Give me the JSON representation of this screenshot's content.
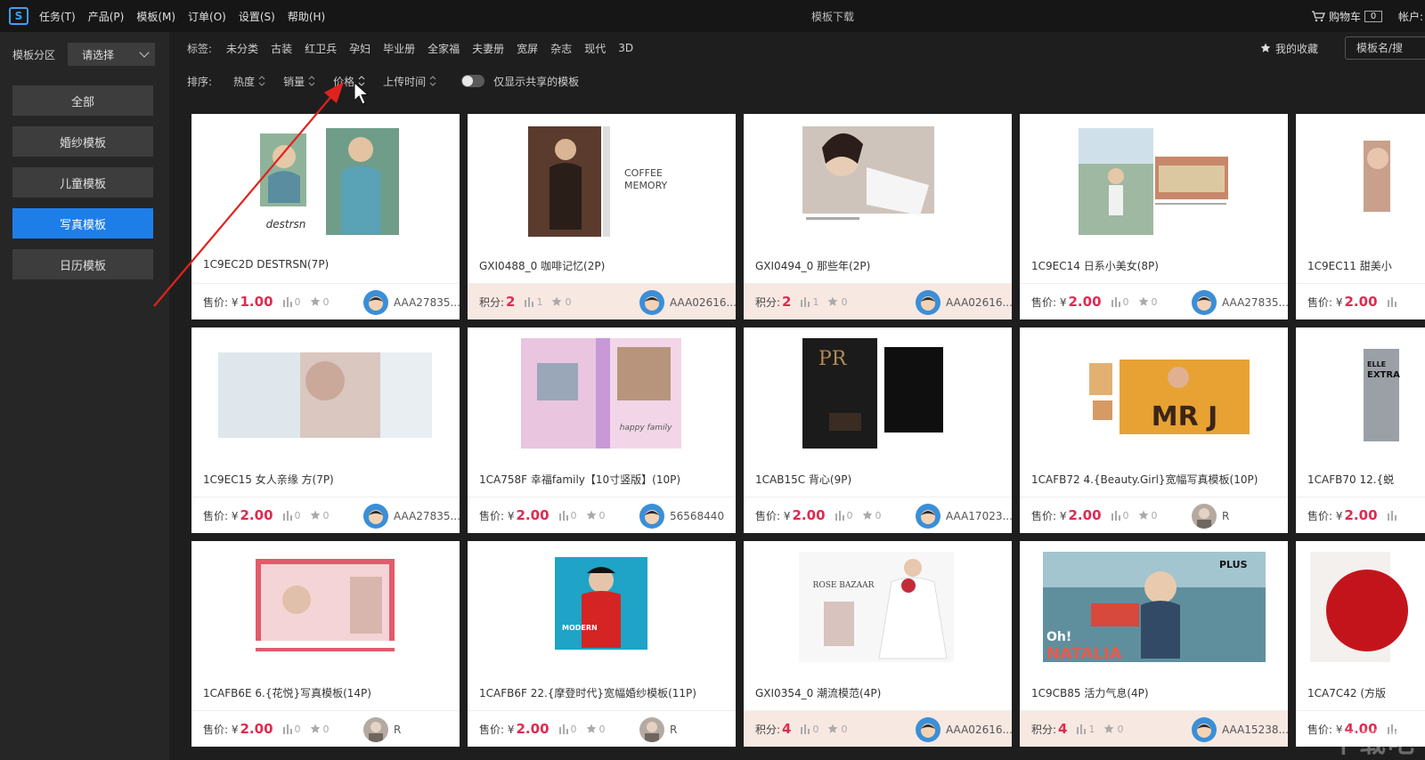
{
  "app": {
    "title": "模板下载",
    "menu": [
      "任务(T)",
      "产品(P)",
      "模板(M)",
      "订单(O)",
      "设置(S)",
      "帮助(H)"
    ],
    "cart_label": "购物车",
    "cart_count": "0",
    "account_label": "帐户:"
  },
  "sidebar": {
    "zone_label": "模板分区",
    "zone_select": "请选择",
    "categories": [
      {
        "label": "全部",
        "active": false
      },
      {
        "label": "婚纱模板",
        "active": false
      },
      {
        "label": "儿童模板",
        "active": false
      },
      {
        "label": "写真模板",
        "active": true
      },
      {
        "label": "日历模板",
        "active": false
      }
    ]
  },
  "tags": {
    "label": "标签:",
    "items": [
      "未分类",
      "古装",
      "红卫兵",
      "孕妇",
      "毕业册",
      "全家福",
      "夫妻册",
      "宽屏",
      "杂志",
      "现代",
      "3D"
    ],
    "favorites_label": "我的收藏",
    "search_placeholder": "模板名/搜"
  },
  "sort": {
    "label": "排序:",
    "items": [
      "热度",
      "销量",
      "价格",
      "上传时间"
    ],
    "toggle_label": "仅显示共享的模板"
  },
  "templates": [
    {
      "title": "1C9EC2D  DESTRSN(7P)",
      "price_label": "售价: ¥",
      "price": "1.00",
      "downloads": "0",
      "stars": "0",
      "author": "AAA27835...",
      "type": "price"
    },
    {
      "title": "GXI0488_0  咖啡记忆(2P)",
      "price_label": "积分:",
      "price": "2",
      "downloads": "1",
      "stars": "0",
      "author": "AAA02616...",
      "type": "points"
    },
    {
      "title": "GXI0494_0  那些年(2P)",
      "price_label": "积分:",
      "price": "2",
      "downloads": "1",
      "stars": "0",
      "author": "AAA02616...",
      "type": "points"
    },
    {
      "title": "1C9EC14  日系小美女(8P)",
      "price_label": "售价: ¥",
      "price": "2.00",
      "downloads": "0",
      "stars": "0",
      "author": "AAA27835...",
      "type": "price"
    },
    {
      "title": "1C9EC11  甜美小",
      "price_label": "售价: ¥",
      "price": "2.00",
      "downloads": "",
      "stars": "",
      "author": "",
      "type": "price"
    },
    {
      "title": "1C9EC15  女人亲缘 方(7P)",
      "price_label": "售价: ¥",
      "price": "2.00",
      "downloads": "0",
      "stars": "0",
      "author": "AAA27835...",
      "type": "price"
    },
    {
      "title": "1CA758F  幸福family【10寸竖版】(10P)",
      "price_label": "售价: ¥",
      "price": "2.00",
      "downloads": "0",
      "stars": "0",
      "author": "56568440",
      "type": "price"
    },
    {
      "title": "1CAB15C  背心(9P)",
      "price_label": "售价: ¥",
      "price": "2.00",
      "downloads": "0",
      "stars": "0",
      "author": "AAA17023...",
      "type": "price"
    },
    {
      "title": "1CAFB72  4.{Beauty.Girl}宽幅写真模板(10P)",
      "price_label": "售价: ¥",
      "price": "2.00",
      "downloads": "0",
      "stars": "0",
      "author": "R",
      "type": "price"
    },
    {
      "title": "1CAFB70  12.{蜕",
      "price_label": "售价: ¥",
      "price": "2.00",
      "downloads": "",
      "stars": "",
      "author": "",
      "type": "price"
    },
    {
      "title": "1CAFB6E  6.{花悦}写真模板(14P)",
      "price_label": "售价: ¥",
      "price": "2.00",
      "downloads": "0",
      "stars": "0",
      "author": "R",
      "type": "price"
    },
    {
      "title": "1CAFB6F  22.{摩登时代}宽幅婚纱模板(11P)",
      "price_label": "售价: ¥",
      "price": "2.00",
      "downloads": "0",
      "stars": "0",
      "author": "R",
      "type": "price"
    },
    {
      "title": "GXI0354_0  潮流模范(4P)",
      "price_label": "积分:",
      "price": "4",
      "downloads": "0",
      "stars": "0",
      "author": "AAA02616...",
      "type": "points"
    },
    {
      "title": "1C9CB85  活力气息(4P)",
      "price_label": "积分:",
      "price": "4",
      "downloads": "1",
      "stars": "0",
      "author": "AAA15238...",
      "type": "points"
    },
    {
      "title": "1CA7C42  (方版",
      "price_label": "售价: ¥",
      "price": "4.00",
      "downloads": "",
      "stars": "",
      "author": "",
      "type": "price"
    }
  ],
  "thumb_text": {
    "t0": "destrsn",
    "t1a": "COFFEE",
    "t1b": "MEMORY",
    "t6": "happy family",
    "t7": "PR",
    "t8": "MR J",
    "t9a": "ELLE",
    "t9b": "EXTRA",
    "t11": "MODERN",
    "t12": "ROSE BAZAAR",
    "t13a": "Oh!",
    "t13b": "NATALIA",
    "t13c": "PLUS"
  },
  "colors": {
    "accent": "#1e7ee8",
    "price": "#e02a50",
    "points_bg": "#f8e8e2",
    "annotation_arrow": "#e0221e"
  },
  "watermark": "下载吧"
}
